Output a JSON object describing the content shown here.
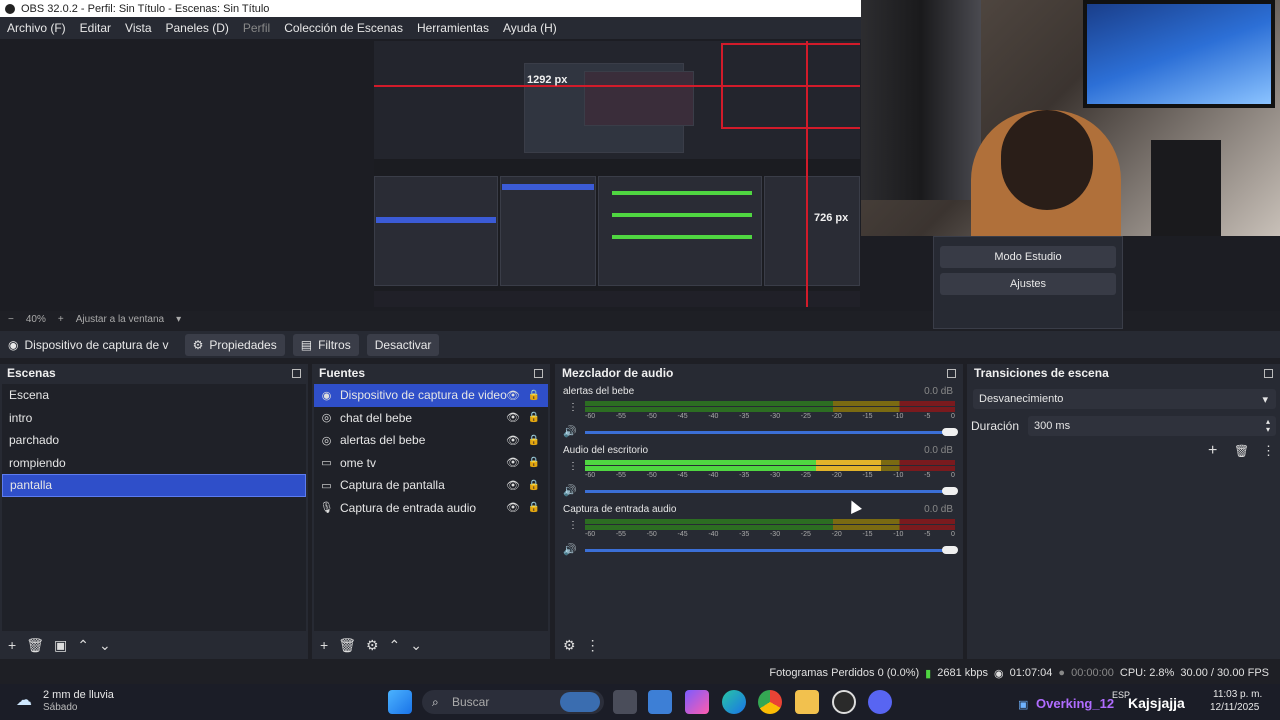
{
  "window": {
    "title": "OBS 32.0.2 - Perfil: Sin Título - Escenas: Sin Título"
  },
  "menu": [
    {
      "label": "Archivo (F)"
    },
    {
      "label": "Editar"
    },
    {
      "label": "Vista"
    },
    {
      "label": "Paneles (D)"
    },
    {
      "label": "Perfil",
      "disabled": true
    },
    {
      "label": "Colección de Escenas"
    },
    {
      "label": "Herramientas"
    },
    {
      "label": "Ayuda (H)"
    }
  ],
  "preview": {
    "width_label": "1292 px",
    "height_label": "726 px",
    "zoom_label": "40%",
    "fit_label": "Ajustar a la ventana"
  },
  "floating": {
    "studio_mode": "Modo Estudio",
    "settings": "Ajustes"
  },
  "toolbar": {
    "source_name": "Dispositivo de captura de v",
    "properties": "Propiedades",
    "filters": "Filtros",
    "deactivate": "Desactivar"
  },
  "scenes": {
    "title": "Escenas",
    "items": [
      "Escena",
      "intro",
      "parchado",
      "rompiendo",
      "pantalla"
    ],
    "selected": "pantalla"
  },
  "sources": {
    "title": "Fuentes",
    "items": [
      {
        "label": "Dispositivo de captura de video",
        "icon": "camera-icon",
        "selected": true
      },
      {
        "label": "chat del bebe",
        "icon": "browser-icon"
      },
      {
        "label": "alertas del bebe",
        "icon": "browser-icon"
      },
      {
        "label": "ome tv",
        "icon": "window-icon"
      },
      {
        "label": "Captura de pantalla",
        "icon": "monitor-icon"
      },
      {
        "label": "Captura de entrada audio",
        "icon": "microphone-icon"
      }
    ]
  },
  "mixer": {
    "title": "Mezclador de audio",
    "scale": [
      "-60",
      "-55",
      "-50",
      "-45",
      "-40",
      "-35",
      "-30",
      "-25",
      "-20",
      "-15",
      "-10",
      "-5",
      "0"
    ],
    "tracks": [
      {
        "name": "alertas del bebe",
        "db": "0.0 dB",
        "level": 0.0
      },
      {
        "name": "Audio del escritorio",
        "db": "0.0 dB",
        "level": 0.8
      },
      {
        "name": "Captura de entrada audio",
        "db": "0.0 dB",
        "level": 0.0
      }
    ]
  },
  "transitions": {
    "title": "Transiciones de escena",
    "selected": "Desvanecimiento",
    "duration_label": "Duración",
    "duration_value": "300 ms"
  },
  "status": {
    "dropped": "Fotogramas Perdidos 0 (0.0%)",
    "bitrate": "2681 kbps",
    "stream_time": "01:07:04",
    "rec_time": "00:00:00",
    "cpu": "CPU: 2.8%",
    "fps": "30.00 / 30.00 FPS"
  },
  "taskbar": {
    "weather_title": "2 mm de lluvia",
    "weather_sub": "Sábado",
    "search_placeholder": "Buscar",
    "lang": "ESP",
    "time": "11:03 p. m.",
    "date": "12/11/2025",
    "overlay_user": "Overking_12",
    "overlay_text": "Kajsjajja"
  }
}
